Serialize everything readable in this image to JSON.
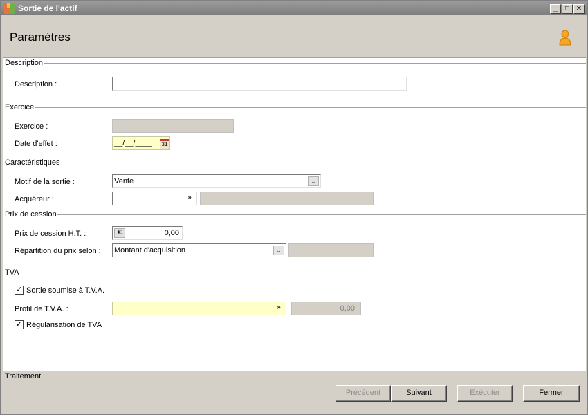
{
  "window": {
    "title": "Sortie de l'actif"
  },
  "header": {
    "title": "Paramètres"
  },
  "sections": {
    "description": {
      "label": "Description",
      "field_label": "Description :",
      "value": ""
    },
    "exercice": {
      "label": "Exercice",
      "exercice_label": "Exercice :",
      "exercice_value": "",
      "date_label": "Date d'effet :",
      "date_value": "__/__/____",
      "calendar_day": "31"
    },
    "caracteristiques": {
      "label": "Caractéristiques",
      "motif_label": "Motif de la sortie :",
      "motif_value": "Vente",
      "acquereur_label": "Acquéreur :",
      "acquereur_value": "",
      "acquereur_detail": ""
    },
    "prix": {
      "label": "Prix de cession",
      "prix_ht_label": "Prix de cession H.T. :",
      "prix_ht_value": "0,00",
      "currency_symbol": "€",
      "repartition_label": "Répartition du prix selon :",
      "repartition_value": "Montant d'acquisition",
      "repartition_detail": ""
    },
    "tva": {
      "label": "TVA",
      "sortie_soumise_label": "Sortie soumise à T.V.A.",
      "sortie_soumise_checked": true,
      "profil_label": "Profil de T.V.A. :",
      "profil_value": "",
      "profil_amount": "0,00",
      "regularisation_label": "Régularisation de TVA",
      "regularisation_checked": true
    }
  },
  "footer": {
    "label": "Traitement",
    "buttons": {
      "precedent": "Précédent",
      "suivant": "Suivant",
      "executer": "Exécuter",
      "fermer": "Fermer"
    }
  },
  "icons": {
    "app": "app-icon",
    "user": "user-icon",
    "calendar": "calendar-icon",
    "euro": "euro-icon",
    "dropdown": "chevron-down-icon"
  },
  "colors": {
    "titlebar": "#8a8a8a",
    "window_bg": "#d4d0c8",
    "content_bg": "#ffffff",
    "highlight_input": "#ffffc8"
  }
}
